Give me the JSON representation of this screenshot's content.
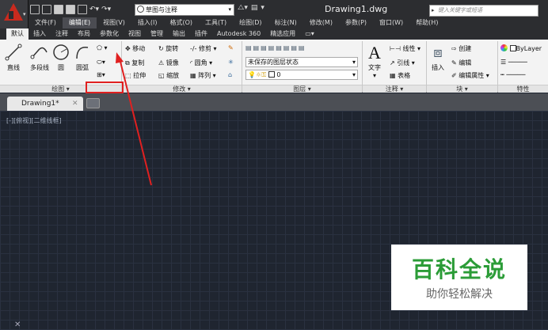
{
  "qat": {
    "workspace": "草图与注释"
  },
  "document_title": "Drawing1.dwg",
  "search": {
    "placeholder": "键入关键字或短语"
  },
  "menubar": [
    "文件(F)",
    "编辑(E)",
    "视图(V)",
    "插入(I)",
    "格式(O)",
    "工具(T)",
    "绘图(D)",
    "标注(N)",
    "修改(M)",
    "参数(P)",
    "窗口(W)",
    "帮助(H)"
  ],
  "ribbon_tabs": [
    "默认",
    "插入",
    "注释",
    "布局",
    "参数化",
    "视图",
    "管理",
    "输出",
    "插件",
    "Autodesk 360",
    "精选应用"
  ],
  "draw_panel": {
    "title": "绘图 ▾",
    "line": "直线",
    "polyline": "多段线",
    "circle": "圆",
    "arc": "圆弧"
  },
  "modify_panel": {
    "title": "修改 ▾",
    "move": "移动",
    "rotate": "旋转",
    "trim": "修剪",
    "copy": "复制",
    "mirror": "镜像",
    "fillet": "圆角",
    "stretch": "拉伸",
    "scale": "缩放",
    "array": "阵列"
  },
  "layers_panel": {
    "title": "图层 ▾",
    "layer_state": "未保存的图层状态",
    "current_layer": "0"
  },
  "annotation_panel": {
    "title": "注释 ▾",
    "text": "文字",
    "linear": "线性",
    "leader": "引线",
    "table": "表格"
  },
  "block_panel": {
    "title": "块 ▾",
    "insert": "插入",
    "create": "创建",
    "edit": "编辑",
    "edit_attr": "编辑属性"
  },
  "properties_panel": {
    "title": "特性",
    "color": "ByLayer"
  },
  "doc_tab": {
    "label": "Drawing1*"
  },
  "viewport_label": "[-][俯视][二维线框]",
  "watermark": {
    "title": "百科全说",
    "subtitle": "助你轻松解决"
  },
  "colors": {
    "accent": "#c92a1e",
    "highlight": "#e02020",
    "canvas": "#1f2530"
  }
}
